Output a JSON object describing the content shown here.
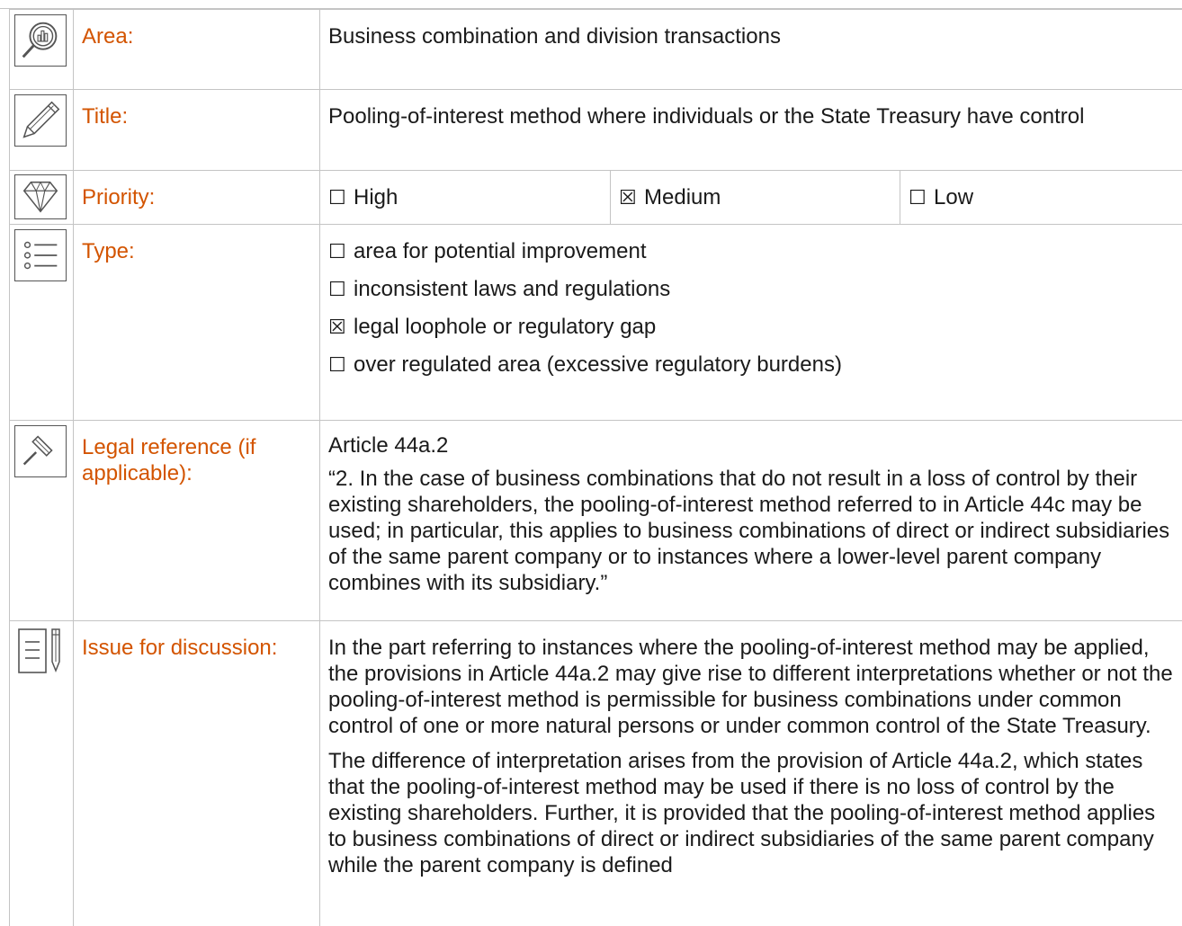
{
  "rows": {
    "area": {
      "label": "Area:",
      "value": "Business combination and division transactions"
    },
    "title": {
      "label": "Title:",
      "value": "Pooling-of-interest method where individuals or the State Treasury have control"
    },
    "priority": {
      "label": "Priority:",
      "options": [
        {
          "box": "☐",
          "label": "High"
        },
        {
          "box": "☒",
          "label": "Medium"
        },
        {
          "box": "☐",
          "label": "Low"
        }
      ],
      "selected": "Medium"
    },
    "type": {
      "label": "Type:",
      "options": [
        {
          "box": "☐",
          "label": "area for potential improvement"
        },
        {
          "box": "☐",
          "label": "inconsistent laws and regulations"
        },
        {
          "box": "☒",
          "label": "legal loophole or regulatory gap"
        },
        {
          "box": "☐",
          "label": "over regulated area (excessive regulatory burdens)"
        }
      ],
      "selected": "legal loophole or regulatory gap"
    },
    "legal": {
      "label": "Legal reference (if applicable):",
      "reference": "Article 44a.2",
      "quote": "“2. In the case of business combinations that do not result in a loss of control by their existing shareholders, the pooling-of-interest method referred to in Article 44c may be used; in particular, this applies to business combinations of direct or indirect subsidiaries of the same parent company or to instances where a lower-level parent company combines with its subsidiary.”"
    },
    "issue": {
      "label": "Issue for discussion:",
      "paragraphs": [
        "In the part referring to instances where the pooling-of-interest method may be applied, the provisions in Article 44a.2 may give rise to different interpretations whether or not the pooling-of-interest method is permissible for business combinations under common control of one or more natural persons or under common control of the State Treasury.",
        "The difference of interpretation arises from the provision of Article 44a.2, which states that the pooling-of-interest method may be used if there is no loss of control by the existing shareholders. Further, it is provided that the pooling-of-interest method applies to business combinations of direct or indirect subsidiaries of the same parent company while the parent company is defined"
      ]
    }
  },
  "icons": [
    "magnifier-chart-icon",
    "pencil-icon",
    "diamond-icon",
    "list-icon",
    "gavel-icon",
    "document-pen-icon"
  ],
  "colors": {
    "label": "#d35400",
    "text": "#1a1a1a",
    "border": "#c4c4c4"
  }
}
